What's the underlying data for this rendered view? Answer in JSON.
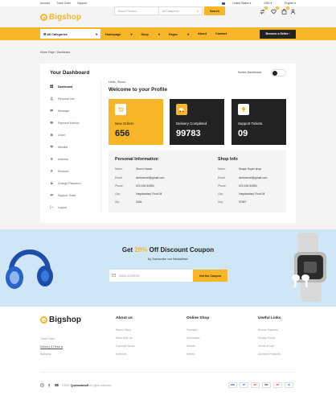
{
  "top_strip": {
    "links": [
      "Account",
      "Track Order",
      "Support"
    ],
    "country": "United States",
    "currency": "USD",
    "language": "English"
  },
  "header": {
    "logo_text": "Bigshop",
    "search_placeholder": "Search Product...",
    "category_select": "All Categories",
    "search_button": "Search",
    "wishlist_count": "0",
    "compare_count": "0",
    "cart_count": "0"
  },
  "nav": {
    "all_categories": "All Categories",
    "links": [
      "Homepage",
      "Shop",
      "Pages",
      "About",
      "Contact"
    ],
    "seller_button": "Become a Seller"
  },
  "breadcrumb": "Home Page / Dashboard",
  "dashboard": {
    "title": "Your Dashboard",
    "toggle_label": "Switch Dashboard",
    "menu": [
      {
        "label": "Dashboard",
        "icon": "grid-icon"
      },
      {
        "label": "Personal Info",
        "icon": "user-icon"
      },
      {
        "label": "Message",
        "icon": "message-icon"
      },
      {
        "label": "Payment Method",
        "icon": "card-icon"
      },
      {
        "label": "Order",
        "icon": "bag-icon"
      },
      {
        "label": "Wishlist",
        "icon": "heart-icon"
      },
      {
        "label": "Address",
        "icon": "pin-icon"
      },
      {
        "label": "Reviews",
        "icon": "star-icon"
      },
      {
        "label": "Change Password",
        "icon": "lock-icon"
      },
      {
        "label": "Support Ticket",
        "icon": "ticket-icon"
      },
      {
        "label": "Logout",
        "icon": "logout-icon"
      }
    ],
    "greeting": "Hello, Shovo",
    "welcome": "Welcome to your Profile",
    "stats": [
      {
        "label": "New Orders",
        "value": "656",
        "icon": "cart-icon"
      },
      {
        "label": "Delivery Completed",
        "value": "99783",
        "icon": "truck-icon"
      },
      {
        "label": "Support Tickets",
        "value": "09",
        "icon": "bulb-icon"
      }
    ],
    "personal": {
      "title": "Personal Information",
      "rows": [
        {
          "k": "Name:",
          "v": "Shovo Hasan"
        },
        {
          "k": "Email:",
          "v": "demoemail@gmail.com"
        },
        {
          "k": "Phone:",
          "v": "023 434 54354"
        },
        {
          "k": "City:",
          "v": "Haydarabad, Rord 34"
        },
        {
          "k": "Zip:",
          "v": "3454"
        }
      ]
    },
    "shop": {
      "title": "Shop Info",
      "rows": [
        {
          "k": "Name:",
          "v": "Shape Super shop"
        },
        {
          "k": "Email:",
          "v": "demoemail@gmail.com"
        },
        {
          "k": "Phone:",
          "v": "023 434 54354"
        },
        {
          "k": "City:",
          "v": "Haydarabad, Rord 34"
        },
        {
          "k": "Key:",
          "v": "97667"
        }
      ]
    }
  },
  "promo": {
    "title_before": "Get ",
    "title_pct": "20%",
    "title_after": " Off Discount Coupon",
    "subtitle": "by Subscribe our Newsletter",
    "email_placeholder": "EMAIL ADDRESS",
    "button": "Get the Coupon"
  },
  "footer": {
    "logo_text": "Bigshop",
    "col1_links": [
      "Track Order",
      "Delivery & Returns",
      "Warranty"
    ],
    "columns": [
      {
        "title": "About us",
        "links": [
          "Rave's Story",
          "Work With Us",
          "Coporate News",
          "Investors"
        ]
      },
      {
        "title": "Online Shop",
        "links": [
          "Furniture",
          "Decoration",
          "Kitchen",
          "Interior"
        ]
      },
      {
        "title": "Useful Links",
        "links": [
          "Secure Payment",
          "Privacy Policy",
          "Terms of Use",
          "Archived Products"
        ]
      }
    ],
    "copyright_prefix": "©2022 ",
    "copyright_brand": "Quomodosoft",
    "copyright_suffix": " All rights reserved",
    "payments": [
      "VISA",
      "PP",
      "MC",
      "PAY",
      "MC",
      "AE"
    ]
  },
  "colors": {
    "accent": "#f7b528",
    "dark": "#222222",
    "promo_bg": "#cfe6f6"
  }
}
